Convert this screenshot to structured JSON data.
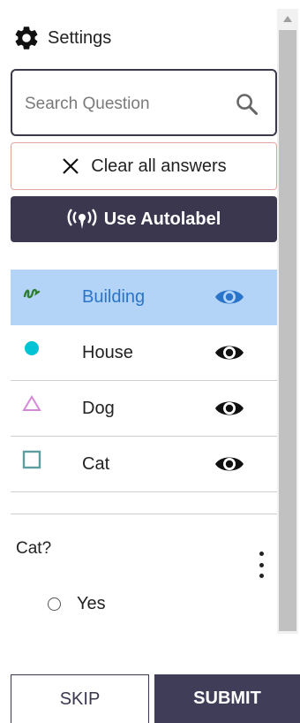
{
  "header": {
    "title": "Settings",
    "icon": "gear-icon"
  },
  "search": {
    "placeholder": "Search Question",
    "value": "",
    "icon": "search-icon"
  },
  "actions": {
    "clear_label": "Clear all answers",
    "autolabel_label": "Use Autolabel"
  },
  "labels": [
    {
      "name": "Building",
      "shape": "polyline",
      "color": "#2e7d32",
      "selected": true,
      "eye_color": "#2a74c9"
    },
    {
      "name": "House",
      "shape": "point",
      "color": "#00c4d4",
      "selected": false,
      "eye_color": "#111111"
    },
    {
      "name": "Dog",
      "shape": "triangle",
      "color": "#d58ad8",
      "selected": false,
      "eye_color": "#111111"
    },
    {
      "name": "Cat",
      "shape": "rectangle",
      "color": "#5f9ea0",
      "selected": false,
      "eye_color": "#111111"
    }
  ],
  "question": {
    "text": "Cat?",
    "options": [
      {
        "label": "Yes",
        "selected": false
      }
    ]
  },
  "footer": {
    "skip_label": "SKIP",
    "submit_label": "SUBMIT"
  },
  "colors": {
    "primary": "#3a374f",
    "highlight": "#b3d4f7",
    "accent_blue": "#2a74c9",
    "clear_border": "#e0a79a"
  }
}
